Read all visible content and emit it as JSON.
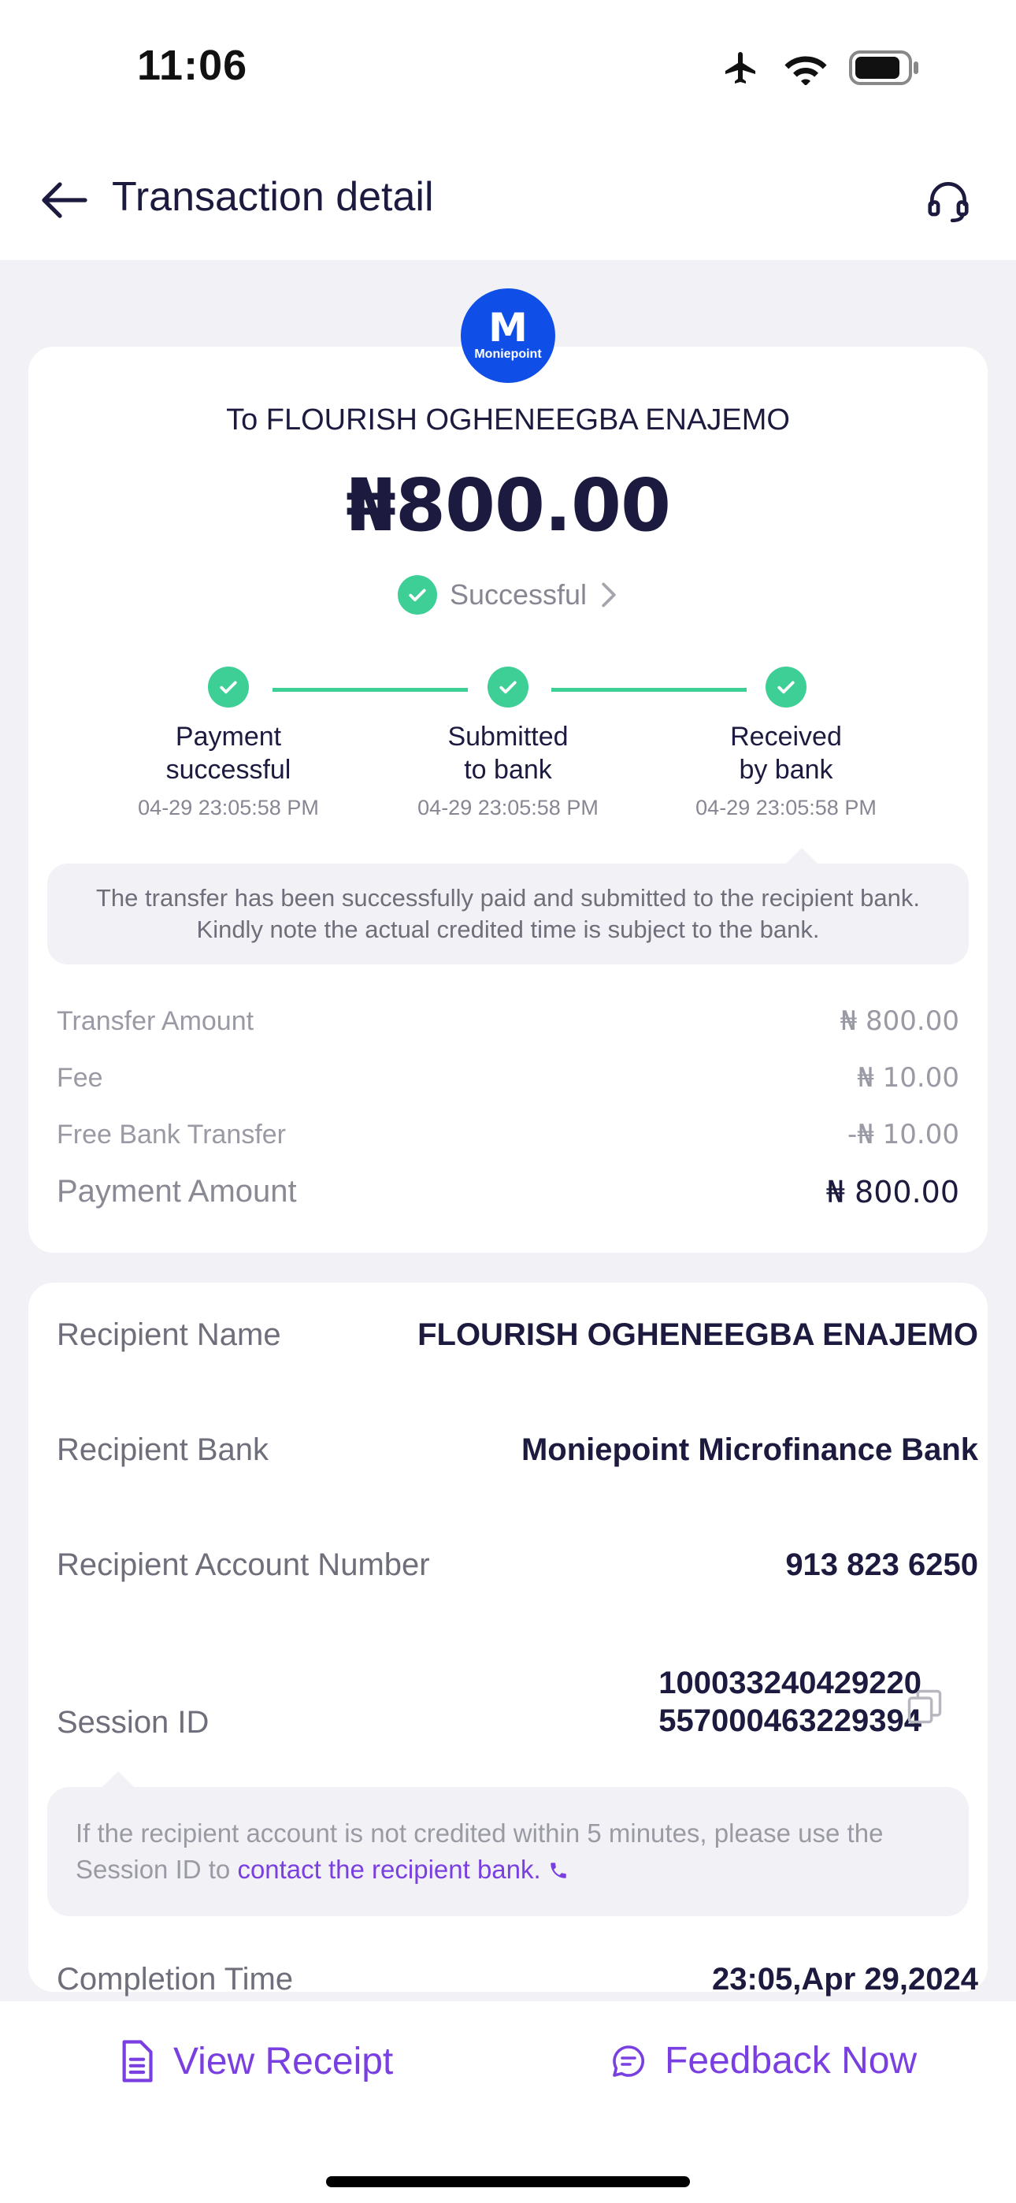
{
  "status_bar": {
    "time": "11:06"
  },
  "header": {
    "title": "Transaction detail"
  },
  "summary": {
    "recipient_line": "To FLOURISH OGHENEEGBA ENAJEMO",
    "amount": "₦800.00",
    "status": "Successful",
    "brand": "Moniepoint",
    "brand_initial": "M"
  },
  "steps": [
    {
      "line1": "Payment",
      "line2": "successful",
      "time": "04-29 23:05:58 PM"
    },
    {
      "line1": "Submitted",
      "line2": "to bank",
      "time": "04-29 23:05:58 PM"
    },
    {
      "line1": "Received",
      "line2": "by bank",
      "time": "04-29 23:05:58 PM"
    }
  ],
  "transfer_note": {
    "line1": "The transfer has been successfully paid and submitted to the recipient bank.",
    "line2": "Kindly note the actual credited time is subject to the bank."
  },
  "fees": {
    "transfer_amount_label": "Transfer Amount",
    "transfer_amount_value": "₦ 800.00",
    "fee_label": "Fee",
    "fee_value": "₦ 10.00",
    "free_transfer_label": "Free Bank Transfer",
    "free_transfer_value": "-₦ 10.00",
    "payment_amount_label": "Payment Amount",
    "payment_amount_value": "₦ 800.00"
  },
  "details": {
    "recipient_name_label": "Recipient Name",
    "recipient_name_value": "FLOURISH OGHENEEGBA ENAJEMO",
    "recipient_bank_label": "Recipient Bank",
    "recipient_bank_value": "Moniepoint Microfinance Bank",
    "account_number_label": "Recipient Account Number",
    "account_number_value": "913 823 6250",
    "session_id_label": "Session ID",
    "session_id_line1": "100033240429220",
    "session_id_line2": "557000463229394",
    "completion_time_label": "Completion Time",
    "completion_time_value": "23:05,Apr 29,2024"
  },
  "session_note": {
    "line1": "If the recipient account is not credited within 5 minutes, please use the",
    "line2_prefix": "Session ID to ",
    "link_text": "contact the recipient bank."
  },
  "bottom": {
    "view_receipt": "View Receipt",
    "feedback": "Feedback Now"
  },
  "colors": {
    "accent": "#7a3fe0",
    "success": "#3ecf97",
    "brand": "#0f4fe8"
  }
}
